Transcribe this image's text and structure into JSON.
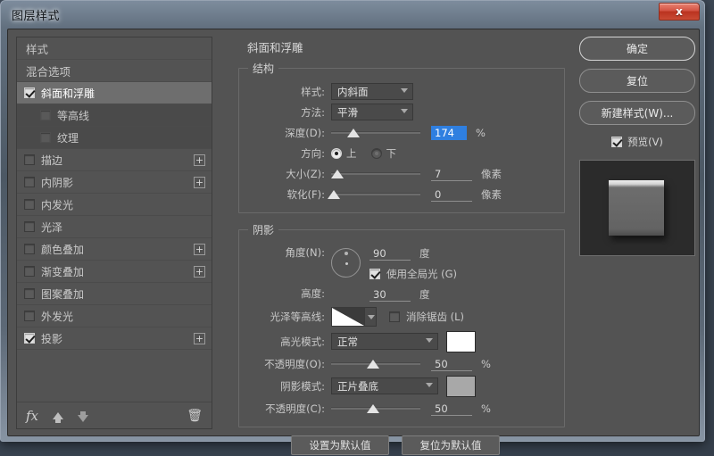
{
  "window": {
    "title": "图层样式",
    "close_label": "x"
  },
  "sidebar": {
    "items": [
      {
        "label": "样式",
        "type": "header",
        "checked": false,
        "plus": false
      },
      {
        "label": "混合选项",
        "type": "header",
        "checked": false,
        "plus": false
      },
      {
        "label": "斜面和浮雕",
        "type": "active",
        "checked": true,
        "plus": false
      },
      {
        "label": "等高线",
        "type": "sub",
        "checked": false,
        "plus": false
      },
      {
        "label": "纹理",
        "type": "sub",
        "checked": false,
        "plus": false
      },
      {
        "label": "描边",
        "type": "normal",
        "checked": false,
        "plus": true
      },
      {
        "label": "内阴影",
        "type": "normal",
        "checked": false,
        "plus": true
      },
      {
        "label": "内发光",
        "type": "normal",
        "checked": false,
        "plus": false
      },
      {
        "label": "光泽",
        "type": "normal",
        "checked": false,
        "plus": false
      },
      {
        "label": "颜色叠加",
        "type": "normal",
        "checked": false,
        "plus": true
      },
      {
        "label": "渐变叠加",
        "type": "normal",
        "checked": false,
        "plus": true
      },
      {
        "label": "图案叠加",
        "type": "normal",
        "checked": false,
        "plus": false
      },
      {
        "label": "外发光",
        "type": "normal",
        "checked": false,
        "plus": false
      },
      {
        "label": "投影",
        "type": "normal",
        "checked": true,
        "plus": true
      }
    ],
    "footer": {
      "fx_icon": "fx-icon",
      "move_up_icon": "arrow-up-icon",
      "move_down_icon": "arrow-down-icon",
      "delete_icon": "trash-icon"
    }
  },
  "main": {
    "effect_title": "斜面和浮雕",
    "structure": {
      "legend": "结构",
      "style_label": "样式:",
      "style_value": "内斜面",
      "technique_label": "方法:",
      "technique_value": "平滑",
      "depth_label": "深度(D):",
      "depth_value": "174",
      "depth_unit": "%",
      "direction_label": "方向:",
      "direction_up": "上",
      "direction_down": "下",
      "size_label": "大小(Z):",
      "size_value": "7",
      "size_unit": "像素",
      "soften_label": "软化(F):",
      "soften_value": "0",
      "soften_unit": "像素"
    },
    "shading": {
      "legend": "阴影",
      "angle_label": "角度(N):",
      "angle_value": "90",
      "angle_unit": "度",
      "global_light_label": "使用全局光 (G)",
      "altitude_label": "高度:",
      "altitude_value": "30",
      "altitude_unit": "度",
      "gloss_contour_label": "光泽等高线:",
      "antialias_label": "消除锯齿 (L)",
      "highlight_mode_label": "高光模式:",
      "highlight_mode_value": "正常",
      "highlight_color": "#ffffff",
      "highlight_opacity_label": "不透明度(O):",
      "highlight_opacity_value": "50",
      "highlight_opacity_unit": "%",
      "shadow_mode_label": "阴影模式:",
      "shadow_mode_value": "正片叠底",
      "shadow_color": "#a8a8a8",
      "shadow_opacity_label": "不透明度(C):",
      "shadow_opacity_value": "50",
      "shadow_opacity_unit": "%"
    }
  },
  "right": {
    "ok_label": "确定",
    "reset_label": "复位",
    "new_style_label": "新建样式(W)...",
    "preview_label": "预览(V)",
    "preview_checked": true
  },
  "bottom": {
    "set_default_label": "设置为默认值",
    "reset_default_label": "复位为默认值"
  }
}
